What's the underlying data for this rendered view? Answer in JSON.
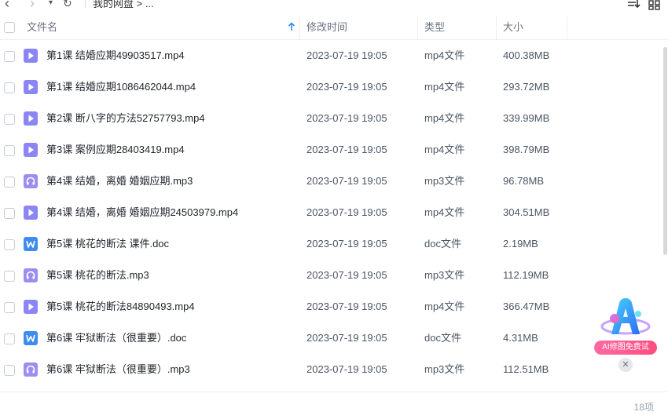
{
  "toolbar": {
    "breadcrumb": "我的网盘  >  ..."
  },
  "header": {
    "name": "文件名",
    "modified": "修改时间",
    "type": "类型",
    "size": "大小"
  },
  "files": [
    {
      "name": "第1课 结婚应期49903517.mp4",
      "time": "2023-07-19 19:05",
      "type": "mp4文件",
      "size": "400.38MB",
      "icon": "video-icon"
    },
    {
      "name": "第1课 结婚应期1086462044.mp4",
      "time": "2023-07-19 19:05",
      "type": "mp4文件",
      "size": "293.72MB",
      "icon": "video-icon"
    },
    {
      "name": "第2课 断八字的方法52757793.mp4",
      "time": "2023-07-19 19:05",
      "type": "mp4文件",
      "size": "339.99MB",
      "icon": "video-icon"
    },
    {
      "name": "第3课 案例应期28403419.mp4",
      "time": "2023-07-19 19:05",
      "type": "mp4文件",
      "size": "398.79MB",
      "icon": "video-icon"
    },
    {
      "name": "第4课 结婚，离婚  婚姻应期.mp3",
      "time": "2023-07-19 19:05",
      "type": "mp3文件",
      "size": "96.78MB",
      "icon": "audio-icon"
    },
    {
      "name": "第4课 结婚，离婚  婚姻应期24503979.mp4",
      "time": "2023-07-19 19:05",
      "type": "mp4文件",
      "size": "304.51MB",
      "icon": "video-icon"
    },
    {
      "name": "第5课 桃花的断法 课件.doc",
      "time": "2023-07-19 19:05",
      "type": "doc文件",
      "size": "2.19MB",
      "icon": "word-icon"
    },
    {
      "name": "第5课 桃花的断法.mp3",
      "time": "2023-07-19 19:05",
      "type": "mp3文件",
      "size": "112.19MB",
      "icon": "audio-icon"
    },
    {
      "name": "第5课 桃花的断法84890493.mp4",
      "time": "2023-07-19 19:05",
      "type": "mp4文件",
      "size": "366.47MB",
      "icon": "video-icon"
    },
    {
      "name": "第6课 牢狱断法（很重要）.doc",
      "time": "2023-07-19 19:05",
      "type": "doc文件",
      "size": "4.31MB",
      "icon": "word-icon"
    },
    {
      "name": "第6课 牢狱断法（很重要）.mp3",
      "time": "2023-07-19 19:05",
      "type": "mp3文件",
      "size": "112.51MB",
      "icon": "audio-icon"
    }
  ],
  "footer": {
    "count": "18项"
  },
  "ai_widget": {
    "label": "AI修图免费试",
    "close": "✕"
  },
  "colors": {
    "video": "#8c86f5",
    "audio": "#9a8ef0",
    "word": "#3f8cf0",
    "accent": "#2f8ef5"
  }
}
